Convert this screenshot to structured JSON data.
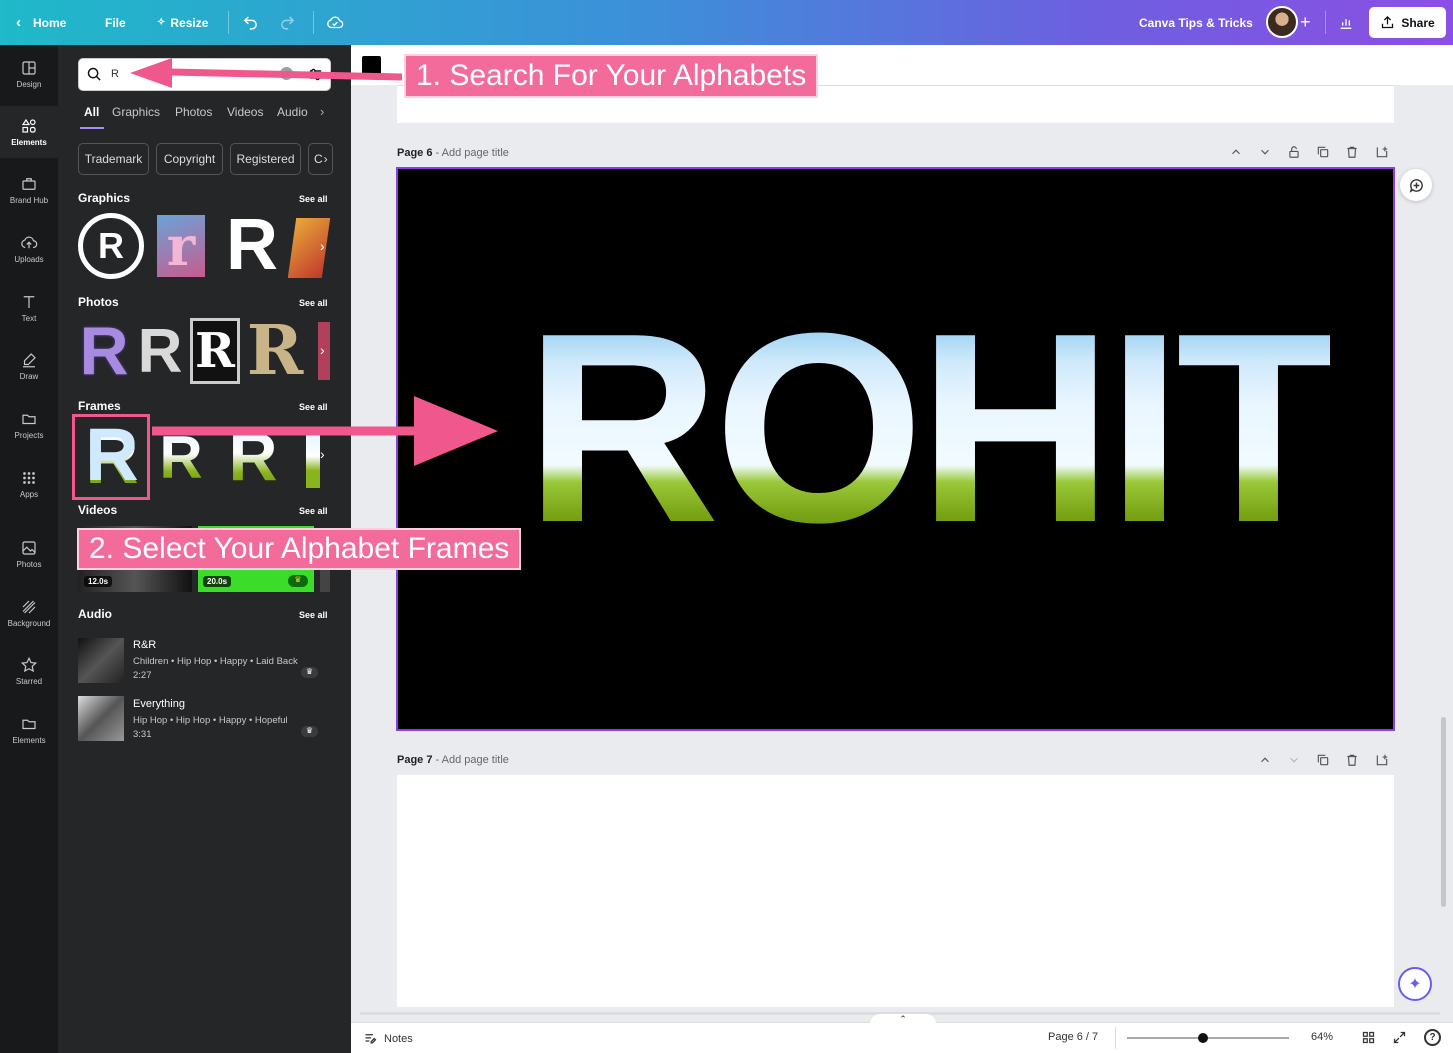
{
  "topbar": {
    "home": "Home",
    "file": "File",
    "resize": "Resize",
    "team": "Canva Tips & Tricks",
    "share": "Share"
  },
  "rail": [
    {
      "label": "Design",
      "icon": "layout-icon"
    },
    {
      "label": "Elements",
      "icon": "shapes-icon"
    },
    {
      "label": "Brand Hub",
      "icon": "briefcase-icon"
    },
    {
      "label": "Uploads",
      "icon": "cloud-upload-icon"
    },
    {
      "label": "Text",
      "icon": "text-icon"
    },
    {
      "label": "Draw",
      "icon": "pen-icon"
    },
    {
      "label": "Projects",
      "icon": "folder-icon"
    },
    {
      "label": "Apps",
      "icon": "grid-icon"
    },
    {
      "label": "Photos",
      "icon": "image-icon"
    },
    {
      "label": "Background",
      "icon": "pattern-icon"
    },
    {
      "label": "Starred",
      "icon": "star-icon"
    },
    {
      "label": "Elements",
      "icon": "folder-icon"
    }
  ],
  "search": {
    "value": "R"
  },
  "tabs": [
    "All",
    "Graphics",
    "Photos",
    "Videos",
    "Audio"
  ],
  "chips": [
    "Trademark",
    "Copyright",
    "Registered",
    "C"
  ],
  "sections": {
    "graphics": "Graphics",
    "photos": "Photos",
    "frames": "Frames",
    "videos": "Videos",
    "audio": "Audio",
    "see_all": "See all"
  },
  "videos": {
    "v1": "12.0s",
    "v2": "20.0s"
  },
  "audio": [
    {
      "title": "R&R",
      "tags": "Children • Hip Hop • Happy • Laid Back",
      "duration": "2:27"
    },
    {
      "title": "Everything",
      "tags": "Hip Hop • Hip Hop • Happy • Hopeful",
      "duration": "3:31"
    }
  ],
  "pages": {
    "p6_label": "Page 6",
    "p6_title": " - Add page title",
    "p7_label": "Page 7",
    "p7_title": " - Add page title"
  },
  "design_text": "ROHIT",
  "callouts": {
    "c1": "1. Search For Your Alphabets",
    "c2": "2. Select Your Alphabet Frames"
  },
  "bottombar": {
    "notes": "Notes",
    "page_indicator": "Page 6 / 7",
    "zoom": "64%",
    "zoom_level": 0.47
  },
  "colors": {
    "accent_pink": "#f26b9a",
    "selection_purple": "#8b3fe3"
  }
}
